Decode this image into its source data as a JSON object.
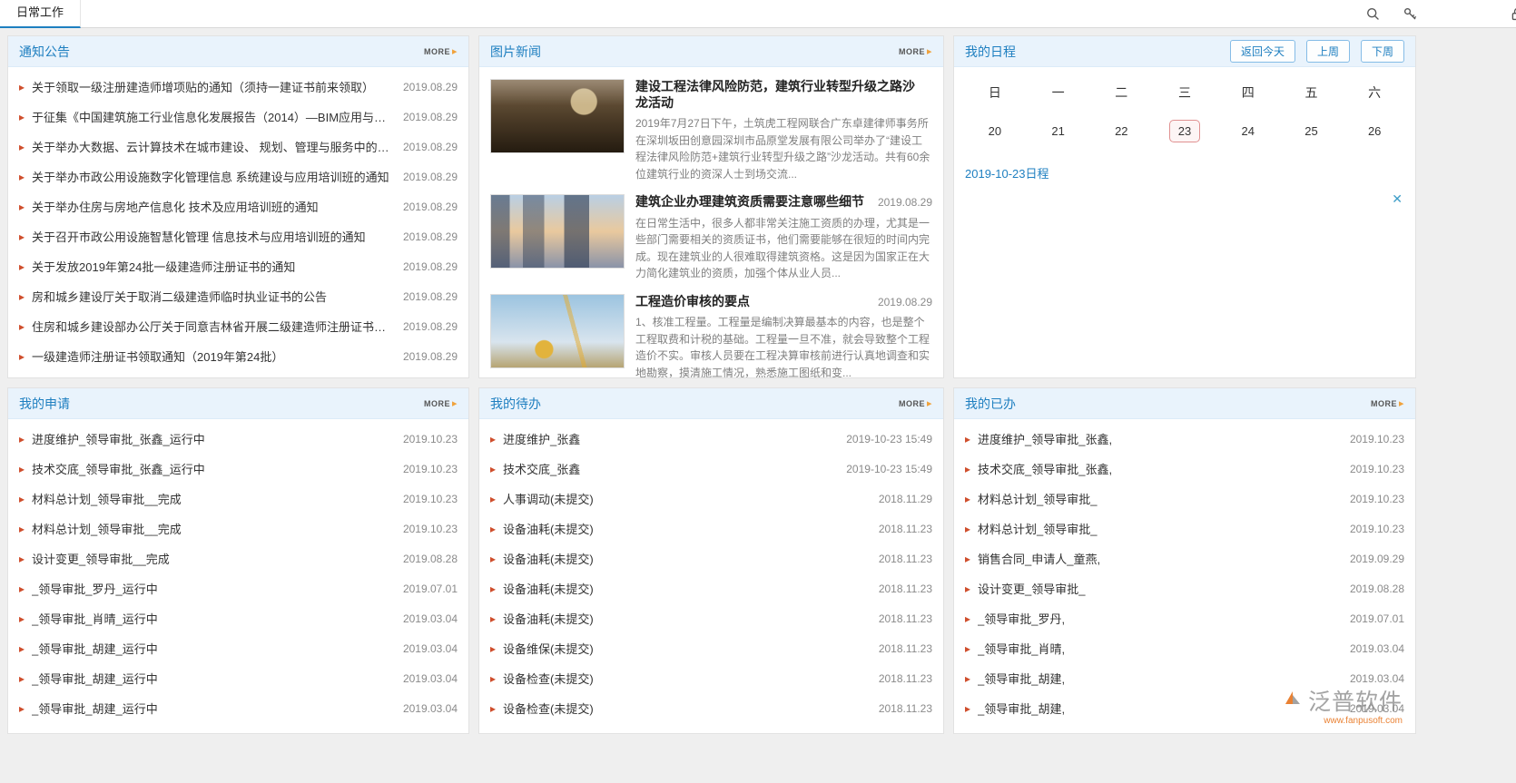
{
  "topbar": {
    "tab": "日常工作"
  },
  "colors": {
    "accent_blue": "#1e7fc0",
    "bullet_orange": "#cf4e2c",
    "selected_day_border": "#e09191",
    "panel_header_bg": "#e9f3fc"
  },
  "panels": {
    "notices": {
      "title": "通知公告",
      "more": "MORE",
      "items": [
        {
          "text": "关于领取一级注册建造师增项贴的通知（须持一建证书前来领取）",
          "date": "2019.08.29"
        },
        {
          "text": "于征集《中国建筑施工行业信息化发展报告（2014）—BIM应用与发...",
          "date": "2019.08.29"
        },
        {
          "text": "关于举办大数据、云计算技术在城市建设、 规划、管理与服务中的应...",
          "date": "2019.08.29"
        },
        {
          "text": "关于举办市政公用设施数字化管理信息 系统建设与应用培训班的通知",
          "date": "2019.08.29"
        },
        {
          "text": "关于举办住房与房地产信息化 技术及应用培训班的通知",
          "date": "2019.08.29"
        },
        {
          "text": "关于召开市政公用设施智慧化管理 信息技术与应用培训班的通知",
          "date": "2019.08.29"
        },
        {
          "text": "关于发放2019年第24批一级建造师注册证书的通知",
          "date": "2019.08.29"
        },
        {
          "text": "房和城乡建设厅关于取消二级建造师临时执业证书的公告",
          "date": "2019.08.29"
        },
        {
          "text": "住房和城乡建设部办公厅关于同意吉林省开展二级建造师注册证书电...",
          "date": "2019.08.29"
        },
        {
          "text": "一级建造师注册证书领取通知（2019年第24批）",
          "date": "2019.08.29"
        }
      ]
    },
    "news": {
      "title": "图片新闻",
      "more": "MORE",
      "items": [
        {
          "title": "建设工程法律风险防范，建筑行业转型升级之路沙龙活动",
          "date": "",
          "body": "2019年7月27日下午，土筑虎工程网联合广东卓建律师事务所在深圳坂田创意园深圳市品原堂发展有限公司举办了“建设工程法律风险防范+建筑行业转型升级之路”沙龙活动。共有60余位建筑行业的资深人士到场交流..."
        },
        {
          "title": "建筑企业办理建筑资质需要注意哪些细节",
          "date": "2019.08.29",
          "body": "在日常生活中，很多人都非常关注施工资质的办理，尤其是一些部门需要相关的资质证书，他们需要能够在很短的时间内完成。现在建筑业的人很难取得建筑资格。这是因为国家正在大力简化建筑业的资质，加强个体从业人员..."
        },
        {
          "title": "工程造价审核的要点",
          "date": "2019.08.29",
          "body": "1、核准工程量。工程量是编制决算最基本的内容，也是整个工程取费和计税的基础。工程量一旦不准，就会导致整个工程造价不实。审核人员要在工程决算审核前进行认真地调查和实地勘察，摸清施工情况，熟悉施工图纸和变..."
        }
      ]
    },
    "schedule": {
      "title": "我的日程",
      "buttons": {
        "today": "返回今天",
        "prev": "上周",
        "next": "下周"
      },
      "weekdays": [
        "日",
        "一",
        "二",
        "三",
        "四",
        "五",
        "六"
      ],
      "days": [
        "20",
        "21",
        "22",
        "23",
        "24",
        "25",
        "26"
      ],
      "selected_day": "23",
      "day_title": "2019-10-23日程"
    },
    "applications": {
      "title": "我的申请",
      "more": "MORE",
      "items": [
        {
          "text": "进度维护_领导审批_张鑫_运行中",
          "date": "2019.10.23"
        },
        {
          "text": "技术交底_领导审批_张鑫_运行中",
          "date": "2019.10.23"
        },
        {
          "text": "材料总计划_领导审批__完成",
          "date": "2019.10.23"
        },
        {
          "text": "材料总计划_领导审批__完成",
          "date": "2019.10.23"
        },
        {
          "text": "设计变更_领导审批__完成",
          "date": "2019.08.28"
        },
        {
          "text": "_领导审批_罗丹_运行中",
          "date": "2019.07.01"
        },
        {
          "text": "_领导审批_肖晴_运行中",
          "date": "2019.03.04"
        },
        {
          "text": "_领导审批_胡建_运行中",
          "date": "2019.03.04"
        },
        {
          "text": "_领导审批_胡建_运行中",
          "date": "2019.03.04"
        },
        {
          "text": "_领导审批_胡建_运行中",
          "date": "2019.03.04"
        }
      ]
    },
    "todos": {
      "title": "我的待办",
      "more": "MORE",
      "items": [
        {
          "text": "进度维护_张鑫",
          "date": "2019-10-23 15:49"
        },
        {
          "text": "技术交底_张鑫",
          "date": "2019-10-23 15:49"
        },
        {
          "text": "人事调动(未提交)",
          "date": "2018.11.29"
        },
        {
          "text": "设备油耗(未提交)",
          "date": "2018.11.23"
        },
        {
          "text": "设备油耗(未提交)",
          "date": "2018.11.23"
        },
        {
          "text": "设备油耗(未提交)",
          "date": "2018.11.23"
        },
        {
          "text": "设备油耗(未提交)",
          "date": "2018.11.23"
        },
        {
          "text": "设备维保(未提交)",
          "date": "2018.11.23"
        },
        {
          "text": "设备检查(未提交)",
          "date": "2018.11.23"
        },
        {
          "text": "设备检查(未提交)",
          "date": "2018.11.23"
        }
      ]
    },
    "done": {
      "title": "我的已办",
      "more": "MORE",
      "items": [
        {
          "text": "进度维护_领导审批_张鑫,",
          "date": "2019.10.23"
        },
        {
          "text": "技术交底_领导审批_张鑫,",
          "date": "2019.10.23"
        },
        {
          "text": "材料总计划_领导审批_",
          "date": "2019.10.23"
        },
        {
          "text": "材料总计划_领导审批_",
          "date": "2019.10.23"
        },
        {
          "text": "销售合同_申请人_童燕,",
          "date": "2019.09.29"
        },
        {
          "text": "设计变更_领导审批_",
          "date": "2019.08.28"
        },
        {
          "text": "_领导审批_罗丹,",
          "date": "2019.07.01"
        },
        {
          "text": "_领导审批_肖晴,",
          "date": "2019.03.04"
        },
        {
          "text": "_领导审批_胡建,",
          "date": "2019.03.04"
        },
        {
          "text": "_领导审批_胡建,",
          "date": "2019.03.04"
        }
      ]
    }
  },
  "watermark": {
    "brand": "泛普软件",
    "url": "www.fanpusoft.com"
  }
}
